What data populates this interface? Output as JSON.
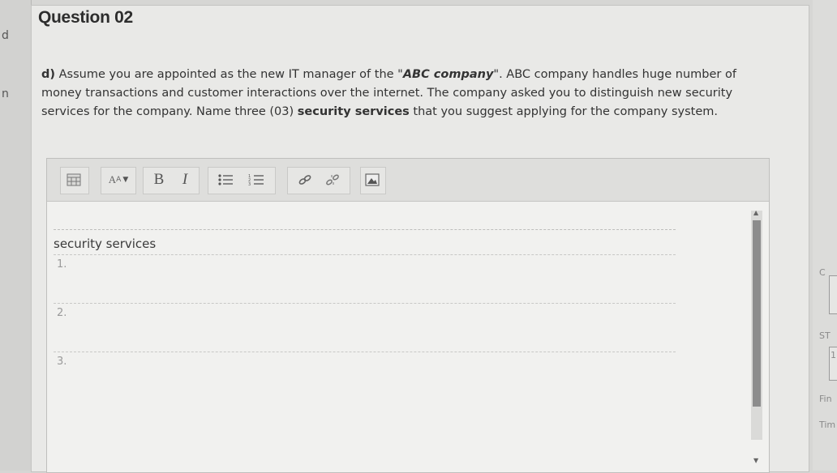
{
  "left_edge": {
    "chars": [
      "d",
      "n"
    ]
  },
  "right_edge": {
    "texts": [
      "C",
      "ST",
      "1",
      "Fin",
      "Tim"
    ]
  },
  "question": {
    "title": "Question 02",
    "part": "d)",
    "line1_a": " Assume you are appointed as the new IT manager of the \"",
    "company_italic": "ABC company",
    "line1_b": "\". ABC company handles huge number of money transactions and customer interactions over the internet. The company asked you to distinguish new security services for the company. Name three (03) ",
    "bold_phrase": "security services",
    "line1_c": " that you suggest applying for the company system."
  },
  "editor": {
    "toolbar": {
      "icons": [
        "table-icon",
        "font-size-icon",
        "bold-icon",
        "italic-icon",
        "bullet-list-icon",
        "numbered-list-icon",
        "link-icon",
        "unlink-icon",
        "image-icon"
      ],
      "font_size_label": "A",
      "bold_label": "B",
      "italic_label": "I"
    },
    "table": {
      "header": "security services",
      "rows": [
        "1.",
        "2.",
        "3."
      ]
    }
  }
}
